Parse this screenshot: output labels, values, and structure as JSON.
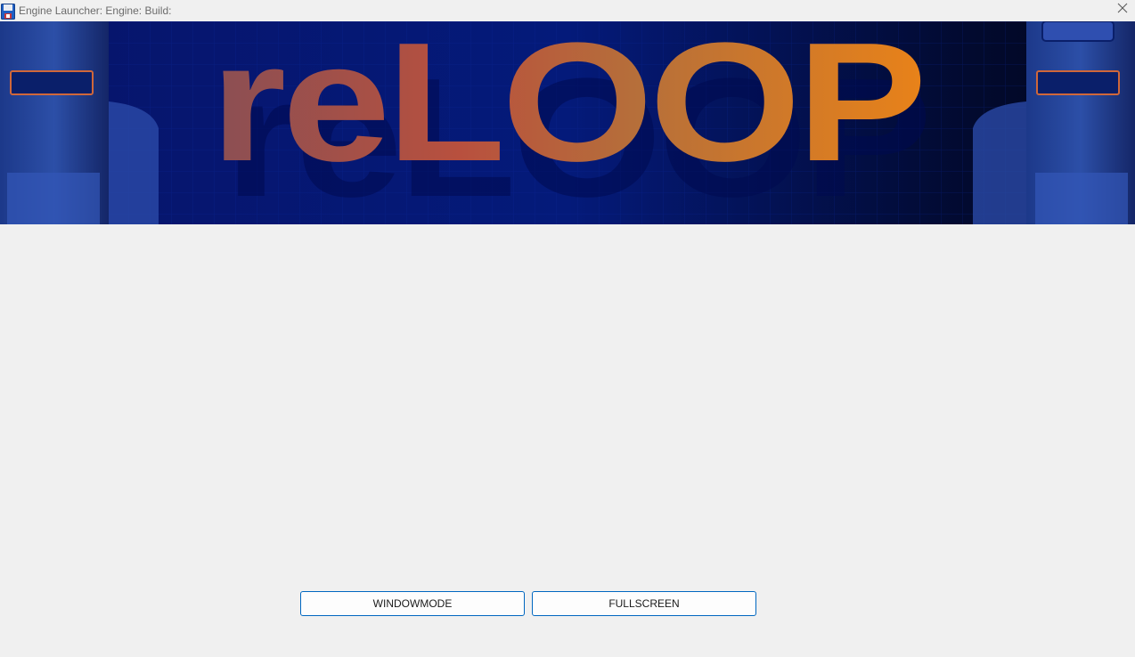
{
  "window": {
    "title": "Engine Launcher: Engine: Build:",
    "app_icon": "floppy-disk-icon",
    "close_icon": "close-icon"
  },
  "banner": {
    "logo_text": "reLOOP",
    "colors": {
      "background": "#03072e",
      "logo_start": "#8a4f54",
      "logo_mid": "#b8503e",
      "logo_end": "#e88219"
    }
  },
  "buttons": {
    "windowmode_label": "WINDOWMODE",
    "fullscreen_label": "FULLSCREEN"
  },
  "colors": {
    "window_bg": "#f0f0f0",
    "button_border": "#0067c0"
  }
}
